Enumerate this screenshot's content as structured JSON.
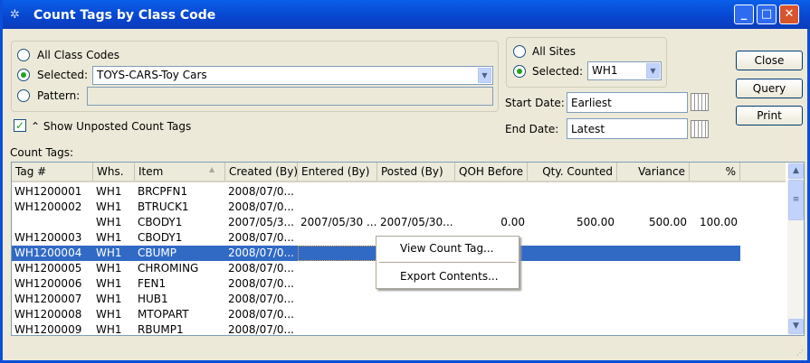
{
  "window": {
    "title": "Count Tags by Class Code"
  },
  "class_code": {
    "all_label": "All Class Codes",
    "selected_label": "Selected:",
    "selected_value": "TOYS-CARS-Toy Cars",
    "pattern_label": "Pattern:",
    "pattern_value": ""
  },
  "sites": {
    "all_label": "All Sites",
    "selected_label": "Selected:",
    "selected_value": "WH1"
  },
  "dates": {
    "start_label": "Start Date:",
    "start_value": "Earliest",
    "end_label": "End Date:",
    "end_value": "Latest"
  },
  "show_unposted": {
    "label": "Show Unposted Count Tags",
    "checked": true
  },
  "buttons": {
    "close": "Close",
    "query": "Query",
    "print": "Print"
  },
  "list": {
    "label": "Count Tags:",
    "columns": [
      "Tag #",
      "Whs.",
      "Item",
      "Created (By)",
      "Entered (By)",
      "Posted (By)",
      "QOH Before",
      "Qty. Counted",
      "Variance",
      "%"
    ],
    "rows": [
      [
        "WH1200001",
        "WH1",
        "BRCPFN1",
        "2008/07/0...",
        "",
        "",
        "",
        "",
        "",
        ""
      ],
      [
        "WH1200002",
        "WH1",
        "BTRUCK1",
        "2008/07/0...",
        "",
        "",
        "",
        "",
        "",
        ""
      ],
      [
        "",
        "WH1",
        "CBODY1",
        "2007/05/3...",
        "2007/05/30 ...",
        "2007/05/30...",
        "0.00",
        "500.00",
        "500.00",
        "100.00"
      ],
      [
        "WH1200003",
        "WH1",
        "CBODY1",
        "2008/07/0...",
        "",
        "",
        "",
        "",
        "",
        ""
      ],
      [
        "WH1200004",
        "WH1",
        "CBUMP",
        "2008/07/0...",
        "",
        "",
        "",
        "",
        "",
        ""
      ],
      [
        "WH1200005",
        "WH1",
        "CHROMING",
        "2008/07/0...",
        "",
        "",
        "",
        "",
        "",
        ""
      ],
      [
        "WH1200006",
        "WH1",
        "FEN1",
        "2008/07/0...",
        "",
        "",
        "",
        "",
        "",
        ""
      ],
      [
        "WH1200007",
        "WH1",
        "HUB1",
        "2008/07/0...",
        "",
        "",
        "",
        "",
        "",
        ""
      ],
      [
        "WH1200008",
        "WH1",
        "MTOPART",
        "2008/07/0...",
        "",
        "",
        "",
        "",
        "",
        ""
      ],
      [
        "WH1200009",
        "WH1",
        "RBUMP1",
        "2008/07/0...",
        "",
        "",
        "",
        "",
        "",
        ""
      ]
    ],
    "selected_index": 4
  },
  "context_menu": {
    "items": [
      "View Count Tag...",
      "Export Contents..."
    ]
  }
}
